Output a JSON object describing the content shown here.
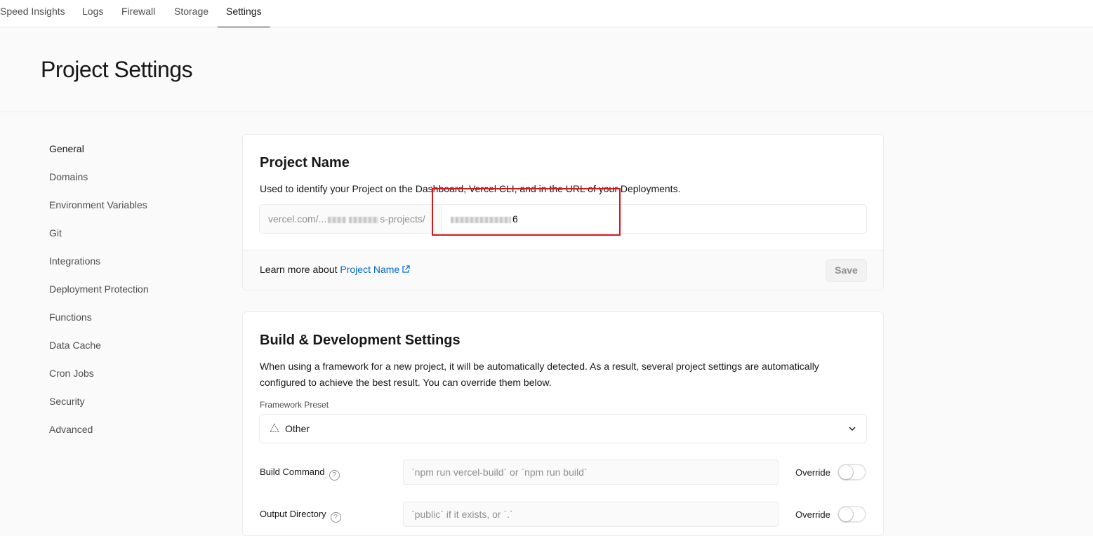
{
  "nav": {
    "tabs": [
      {
        "label": "Speed Insights"
      },
      {
        "label": "Logs"
      },
      {
        "label": "Firewall"
      },
      {
        "label": "Storage"
      },
      {
        "label": "Settings",
        "active": true
      }
    ]
  },
  "page": {
    "title": "Project Settings"
  },
  "sidebar": {
    "items": [
      {
        "label": "General",
        "active": true
      },
      {
        "label": "Domains"
      },
      {
        "label": "Environment Variables"
      },
      {
        "label": "Git"
      },
      {
        "label": "Integrations"
      },
      {
        "label": "Deployment Protection"
      },
      {
        "label": "Functions"
      },
      {
        "label": "Data Cache"
      },
      {
        "label": "Cron Jobs"
      },
      {
        "label": "Security"
      },
      {
        "label": "Advanced"
      }
    ]
  },
  "project_name": {
    "title": "Project Name",
    "description": "Used to identify your Project on the Dashboard, Vercel CLI, and in the URL of your Deployments.",
    "prefix_start": "vercel.com/...",
    "prefix_end": "s-projects/",
    "value_suffix": "6",
    "footer_text": "Learn more about ",
    "footer_link": "Project Name",
    "save_label": "Save"
  },
  "build": {
    "title": "Build & Development Settings",
    "description_line1": "When using a framework for a new project, it will be automatically detected. As a result, several project settings are automatically",
    "description_line2": "configured to achieve the best result. You can override them below.",
    "framework_label": "Framework Preset",
    "framework_value": "Other",
    "build_command_label": "Build Command",
    "build_command_placeholder": "`npm run vercel-build` or `npm run build`",
    "output_dir_label": "Output Directory",
    "output_dir_placeholder": "`public` if it exists, or `.`",
    "override_label": "Override"
  },
  "colors": {
    "accent": "#0068d6",
    "highlight": "#d0191f"
  }
}
